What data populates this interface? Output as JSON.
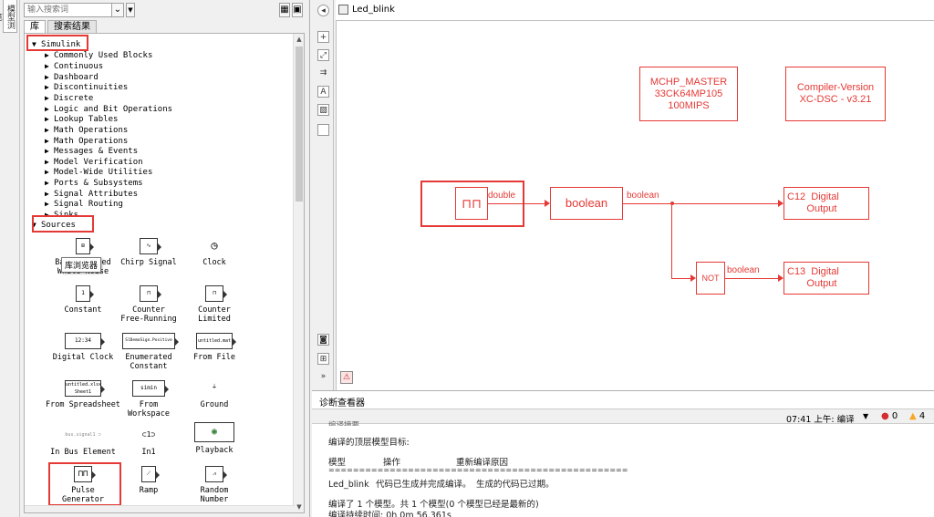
{
  "side_strip": {
    "tab_label": "模型浏览"
  },
  "library": {
    "search_placeholder": "输入搜索词",
    "tabs": [
      "库",
      "搜索结果"
    ],
    "tree": {
      "root": "Simulink",
      "children": [
        "Commonly Used Blocks",
        "Continuous",
        "Dashboard",
        "Discontinuities",
        "Discrete",
        "Logic and Bit Operations",
        "Lookup Tables",
        "Math Operations",
        "Math Operations",
        "Messages & Events",
        "Model Verification",
        "Model-Wide Utilities",
        "Ports & Subsystems",
        "Signal Attributes",
        "Signal Routing",
        "Sinks"
      ],
      "open_section": "Sources"
    },
    "tooltip": "库浏览器",
    "blocks": [
      {
        "label": "Band-Limited\nWhite Noise",
        "icon": "⊞"
      },
      {
        "label": "Chirp Signal",
        "icon": "∿"
      },
      {
        "label": "Clock",
        "icon": "◷"
      },
      {
        "label": "Constant",
        "icon": "1"
      },
      {
        "label": "Counter\nFree-Running",
        "icon": "⊓"
      },
      {
        "label": "Counter\nLimited",
        "icon": "⊓"
      },
      {
        "label": "Digital Clock",
        "icon": "12:34"
      },
      {
        "label": "Enumerated\nConstant",
        "icon": "SlDemoSign.Positive"
      },
      {
        "label": "From File",
        "icon": "untitled.mat"
      },
      {
        "label": "From Spreadsheet",
        "icon": "untitled.xlsx Sheet1"
      },
      {
        "label": "From\nWorkspace",
        "icon": "simin"
      },
      {
        "label": "Ground",
        "icon": "⏚"
      },
      {
        "label": "In Bus Element",
        "icon": "bus.signal1"
      },
      {
        "label": "In1",
        "icon": "1"
      },
      {
        "label": "Playback",
        "icon": "▶"
      },
      {
        "label": "Pulse\nGenerator",
        "icon": "⊓⊓"
      },
      {
        "label": "Ramp",
        "icon": "⟋"
      },
      {
        "label": "Random\nNumber",
        "icon": "⩘"
      }
    ]
  },
  "editor": {
    "breadcrumb": "Led_blink",
    "toolbar_icons": [
      "back-icon",
      "zoom-in-icon",
      "fit-icon",
      "arrows-icon",
      "text-icon",
      "image-icon",
      "area-icon",
      "camera-icon",
      "tree-icon",
      "more-icon",
      "report-icon"
    ],
    "master_block": "MCHP_MASTER\n33CK64MP105\n100MIPS",
    "compiler_block": "Compiler-Version\nXC-DSC - v3.21",
    "boolean_block": "boolean",
    "not_block": "NOT",
    "c12_block": "C12  Digital\n       Output",
    "c13_block": "C13  Digital\n       Output",
    "sig_double": "double",
    "sig_boolean1": "boolean",
    "sig_boolean2": "boolean",
    "accent": "#e53935"
  },
  "diagnostics": {
    "title": "诊断查看器",
    "time": "07:41 上午: 编译",
    "errors": "0",
    "warnings": "4",
    "cut_heading": "编译摘要",
    "line_target": "编译的顶层模型目标:",
    "col_model": "模型",
    "col_action": "操作",
    "col_reason": "重新编译原因",
    "separator": "=================================================",
    "row_model": "Led_blink",
    "row_action": "代码已生成并完成编译。",
    "row_reason": "生成的代码已过期。",
    "summary": "编译了 1 个模型。共 1 个模型(0 个模型已经是最新的)",
    "duration": "编译持续时间: 0h 0m 56.361s"
  }
}
